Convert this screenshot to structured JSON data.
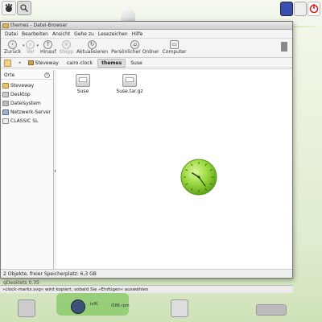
{
  "window": {
    "title": "themes - Datei-Browser"
  },
  "menubar": {
    "items": [
      "Datei",
      "Bearbeiten",
      "Ansicht",
      "Gehe zu",
      "Lesezeichen",
      "Hilfe"
    ]
  },
  "toolbar": {
    "back": "Zurück",
    "forward": "Vor",
    "up": "Hinauf",
    "stop": "Stopp",
    "reload": "Aktualisieren",
    "home": "Persönlicher Ordner",
    "computer": "Computer"
  },
  "location": {
    "crumbs": [
      "Steveway",
      "cairo-clock",
      "themes",
      "Suse"
    ],
    "active": "themes"
  },
  "sidebar": {
    "header": "Orte",
    "items": [
      "Steveway",
      "Desktop",
      "Dateisystem",
      "Netzwerk-Server",
      "CLASSIC SL"
    ]
  },
  "files": [
    {
      "name": "Suse"
    },
    {
      "name": "Suse.tar.gz"
    }
  ],
  "statusbar": {
    "text": "2 Objekte, freier Speicherplatz: 6,3 GB"
  },
  "desktop": {
    "label1": "gDesklets 0.35",
    "message": "»clock-marks.svg« wird kopiert, sobald Sie »Einfügen« auswählen",
    "file_a": "ioM.",
    "file_b": "i586.rpm"
  },
  "colors": {
    "clock_green": "#8ed12e",
    "desktop_bg": "#e9f2dc"
  }
}
